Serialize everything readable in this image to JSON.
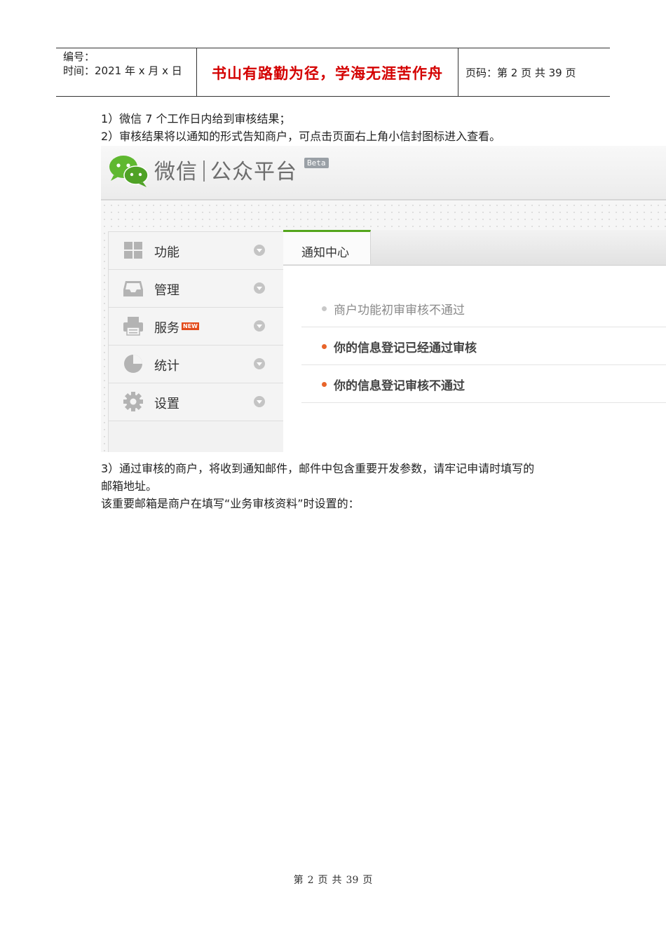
{
  "header": {
    "number_label": "编号：",
    "time_label": "时间：2021 年 x 月 x 日",
    "motto": "书山有路勤为径，学海无涯苦作舟",
    "page_label": "页码：第 2 页  共 39 页"
  },
  "body": {
    "p1": "1）微信 7 个工作日内给到审核结果；",
    "p2": "2）审核结果将以通知的形式告知商户，可点击页面右上角小信封图标进入查看。",
    "p3_line1": "3）通过审核的商户，将收到通知邮件，邮件中包含重要开发参数，请牢记申请时填写的",
    "p3_line2": "邮箱地址。",
    "p4": "该重要邮箱是商户在填写“业务审核资料”时设置的："
  },
  "screenshot": {
    "brand": "微信",
    "platform": "公众平台",
    "beta": "Beta",
    "sidebar": [
      {
        "label": "功能",
        "icon": "grid-icon"
      },
      {
        "label": "管理",
        "icon": "inbox-icon"
      },
      {
        "label": "服务",
        "icon": "printer-icon",
        "badge": "NEW"
      },
      {
        "label": "统计",
        "icon": "pie-chart-icon"
      },
      {
        "label": "设置",
        "icon": "gear-icon"
      }
    ],
    "tab": "通知中心",
    "messages": [
      {
        "text": "商户功能初审审核不通过",
        "read": true
      },
      {
        "text": "你的信息登记已经通过审核",
        "read": false
      },
      {
        "text": "你的信息登记审核不通过",
        "read": false
      }
    ],
    "colors": {
      "accent_green": "#54a51c",
      "unread_dot": "#e8642a",
      "read_dot": "#c8c8c8",
      "badge": "#e34a1a"
    }
  },
  "footer": {
    "di": "第",
    "num": "2",
    "ye": "页",
    "gong": "共",
    "total": "39",
    "ye2": "页"
  }
}
